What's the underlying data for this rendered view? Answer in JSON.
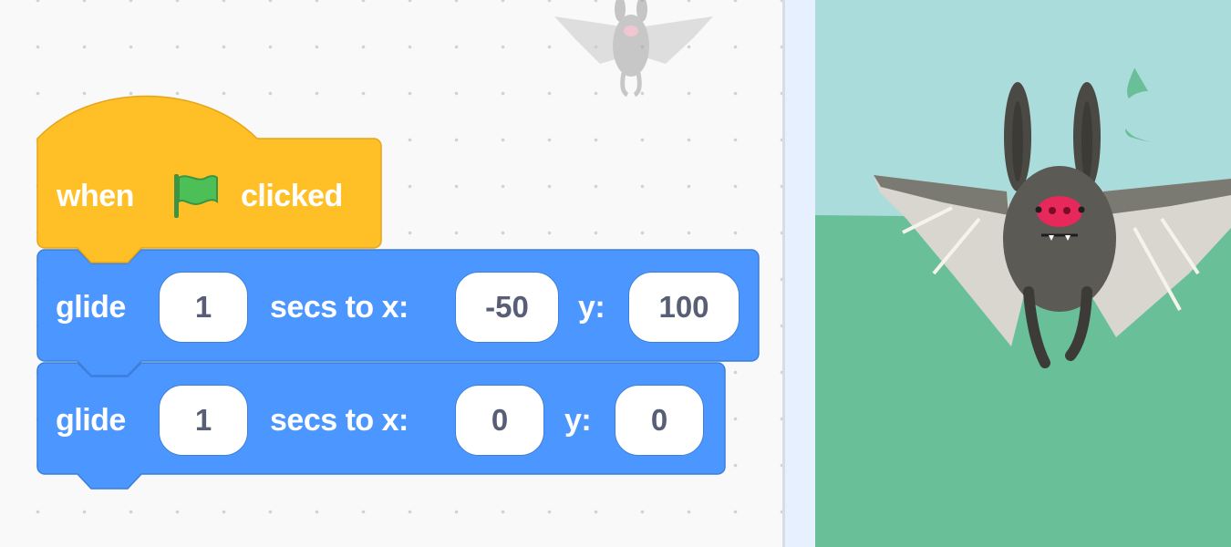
{
  "script": {
    "hat_block": {
      "word_when": "when",
      "flag_icon": "green-flag-icon",
      "word_clicked": "clicked"
    },
    "glide_blocks": [
      {
        "label": "glide",
        "secs": "1",
        "secs_to_x_label": "secs to x:",
        "x": "-50",
        "y_label": "y:",
        "y": "100"
      },
      {
        "label": "glide",
        "secs": "1",
        "secs_to_x_label": "secs to x:",
        "x": "0",
        "y_label": "y:",
        "y": "0"
      }
    ]
  },
  "colors": {
    "events_block": "#ffbf26",
    "motion_block": "#4c97ff",
    "flag_green": "#4cbf56",
    "stage_sky": "#abdcdc",
    "stage_ground": "#69bf97",
    "bat_body": "#5b5a55",
    "bat_nose": "#e6285a"
  }
}
